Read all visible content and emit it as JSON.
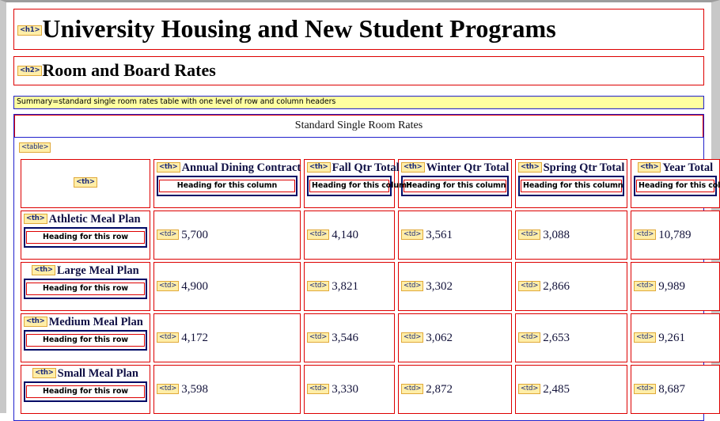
{
  "document": {
    "h1": {
      "tag": "<h1>",
      "text": "University Housing and New Student Programs"
    },
    "h2": {
      "tag": "<h2>",
      "text": "Room and Board Rates"
    },
    "summary": "Summary=standard single room rates table with one level of row and column headers",
    "table_tag": "<table>",
    "caption": "Standard Single Room Rates",
    "th_tag": "<th>",
    "td_tag": "<td>",
    "column_note": "Heading for this column",
    "row_note": "Heading for this row"
  },
  "colors": {
    "tag_background": "#ffeea8",
    "tag_border": "#e0a93a",
    "tag_text": "#1a2a7a",
    "summary_background": "#ffffa0",
    "summary_border": "#2222cc",
    "cell_border": "#dd0000",
    "navy_border": "#000a66",
    "heading_text": "#101045"
  },
  "chart_data": {
    "type": "table",
    "title": "Standard Single Room Rates",
    "columns": [
      "",
      "Annual Dining Contract",
      "Fall Qtr Total",
      "Winter Qtr Total",
      "Spring Qtr Total",
      "Year Total"
    ],
    "rows": [
      {
        "header": "Athletic Meal Plan",
        "values": [
          "5,700",
          "4,140",
          "3,561",
          "3,088",
          "10,789"
        ]
      },
      {
        "header": "Large Meal Plan",
        "values": [
          "4,900",
          "3,821",
          "3,302",
          "2,866",
          "9,989"
        ]
      },
      {
        "header": "Medium Meal Plan",
        "values": [
          "4,172",
          "3,546",
          "3,062",
          "2,653",
          "9,261"
        ]
      },
      {
        "header": "Small Meal Plan",
        "values": [
          "3,598",
          "3,330",
          "2,872",
          "2,485",
          "8,687"
        ]
      }
    ]
  }
}
